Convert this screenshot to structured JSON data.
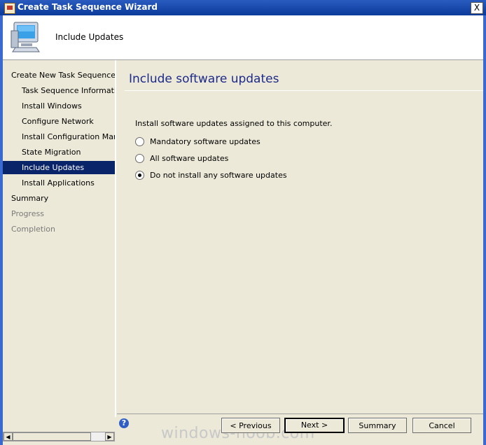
{
  "window": {
    "title": "Create Task Sequence Wizard",
    "close_symbol": "X"
  },
  "header": {
    "title": "Include Updates",
    "icon": "computer-icon"
  },
  "nav": {
    "items": [
      {
        "label": "Create New Task Sequence",
        "level": 0,
        "state": "normal"
      },
      {
        "label": "Task Sequence Information",
        "level": 1,
        "state": "normal"
      },
      {
        "label": "Install Windows",
        "level": 1,
        "state": "normal"
      },
      {
        "label": "Configure Network",
        "level": 1,
        "state": "normal"
      },
      {
        "label": "Install Configuration Manag",
        "level": 1,
        "state": "normal"
      },
      {
        "label": "State Migration",
        "level": 1,
        "state": "normal"
      },
      {
        "label": "Include Updates",
        "level": 1,
        "state": "selected"
      },
      {
        "label": "Install Applications",
        "level": 1,
        "state": "normal"
      },
      {
        "label": "Summary",
        "level": 0,
        "state": "normal"
      },
      {
        "label": "Progress",
        "level": 0,
        "state": "disabled"
      },
      {
        "label": "Completion",
        "level": 0,
        "state": "disabled"
      }
    ]
  },
  "main": {
    "title": "Include software updates",
    "description": "Install software updates assigned to this computer.",
    "options": [
      {
        "label": "Mandatory software updates",
        "checked": false
      },
      {
        "label": "All software updates",
        "checked": false
      },
      {
        "label": "Do not install any software updates",
        "checked": true
      }
    ]
  },
  "footer": {
    "help_icon": "help-icon",
    "previous_label": "< Previous",
    "next_label": "Next >",
    "summary_label": "Summary",
    "cancel_label": "Cancel"
  },
  "watermark": "windows-noob.com",
  "colors": {
    "titlebar": "#0a3a9a",
    "selected_bg": "#0a246a",
    "heading": "#1c2a8a"
  }
}
